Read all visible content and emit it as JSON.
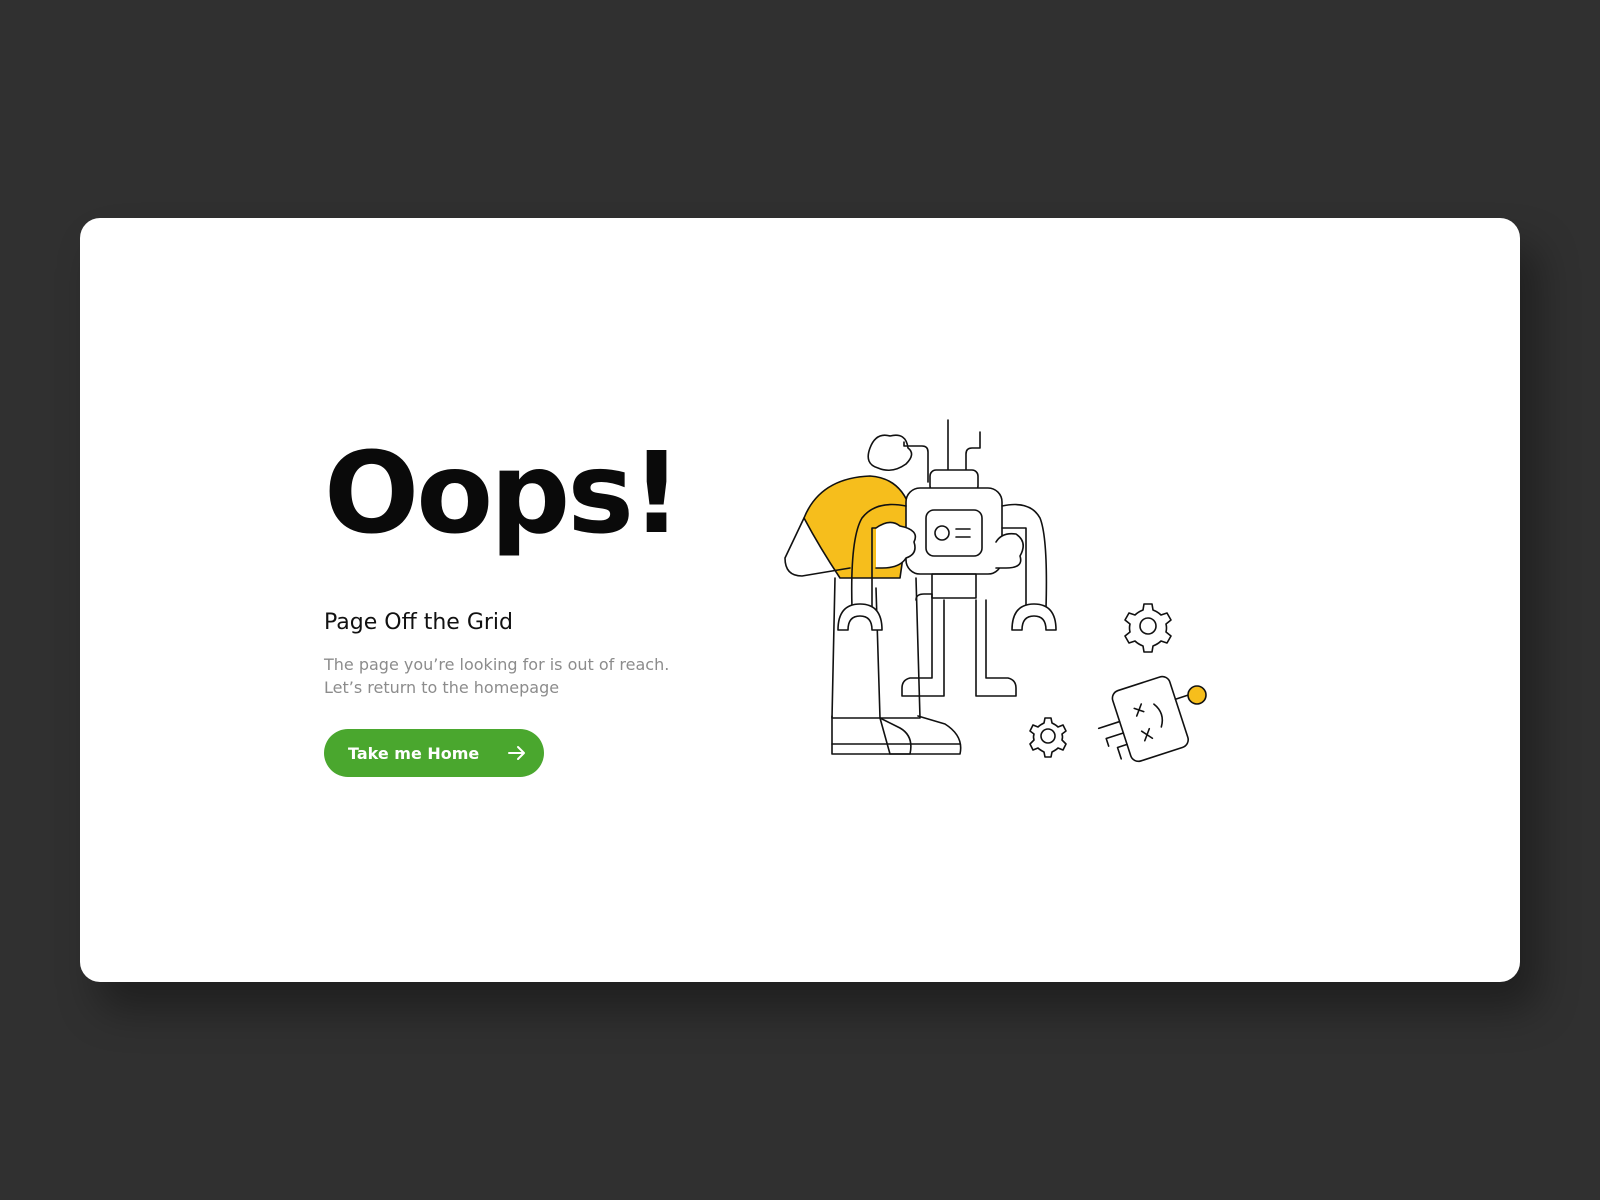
{
  "error_page": {
    "title": "Oops!",
    "subtitle": "Page Off the Grid",
    "description_line1": "The page you’re looking for is out of reach.",
    "description_line2": "Let’s return to the homepage",
    "button_label": "Take me Home",
    "button_icon": "arrow-right-icon"
  },
  "illustration": {
    "subject": "person-holding-robot",
    "accent_color": "#f6be1c",
    "line_color": "#111111"
  },
  "colors": {
    "background": "#303030",
    "card": "#ffffff",
    "accent": "#4aa72e",
    "text_primary": "#0a0a0a",
    "text_secondary": "#8c8c8c"
  }
}
